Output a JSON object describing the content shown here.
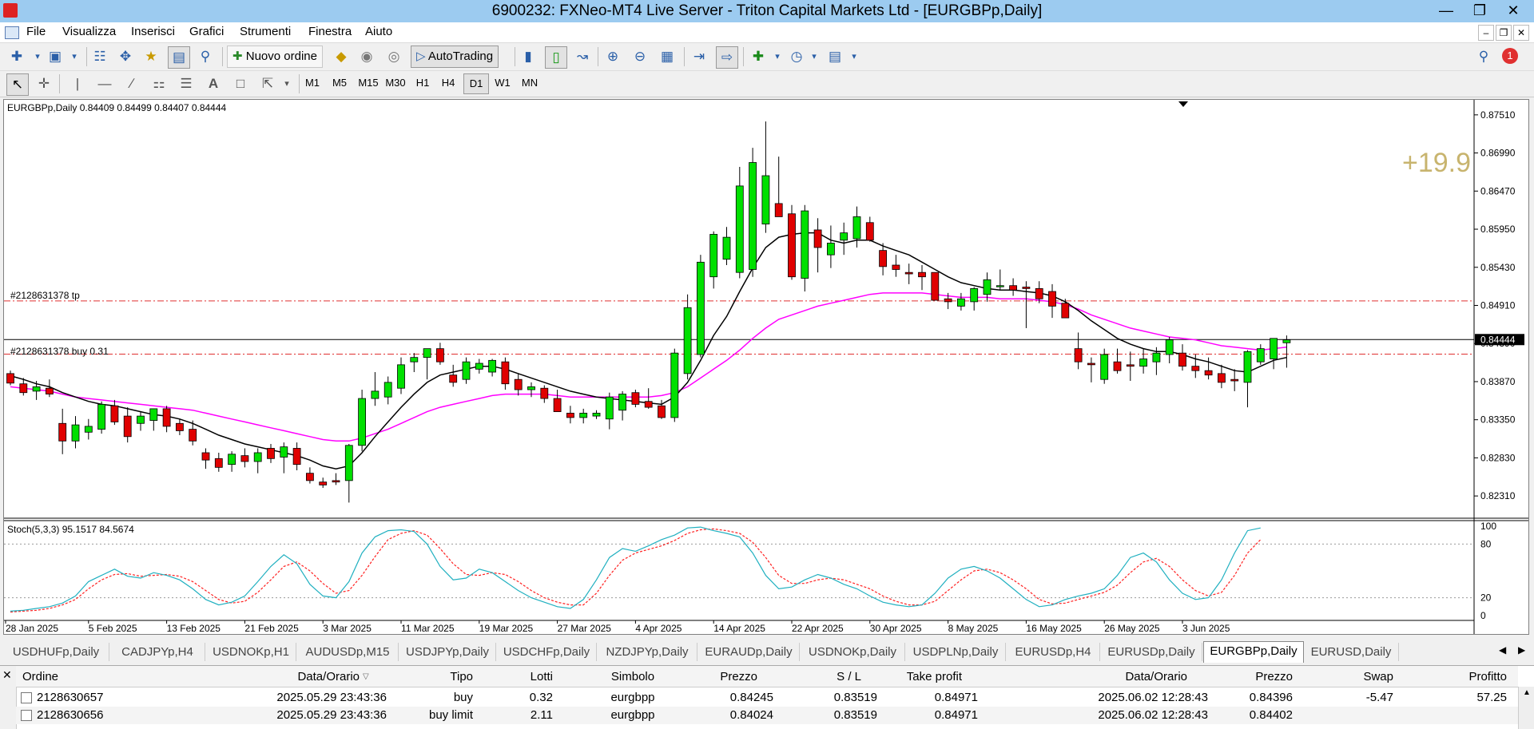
{
  "window": {
    "title": "6900232: FXNeo-MT4 Live Server - Triton Capital Markets Ltd - [EURGBPp,Daily]"
  },
  "menu": [
    "File",
    "Visualizza",
    "Inserisci",
    "Grafici",
    "Strumenti",
    "Finestra",
    "Aiuto"
  ],
  "toolbar": {
    "new_order_label": "Nuovo ordine",
    "autotrading_label": "AutoTrading",
    "alert_badge": "1"
  },
  "timeframes": [
    "M1",
    "M5",
    "M15",
    "M30",
    "H1",
    "H4",
    "D1",
    "W1",
    "MN"
  ],
  "active_timeframe": "D1",
  "chart": {
    "header": "EURGBPp,Daily  0.84409 0.84499 0.84407 0.84444",
    "profit_overlay": "+19.9",
    "tp_line_label": "#2128631378 tp",
    "buy_line_label": "#2128631378 buy 0.31",
    "current_price": "0.84444",
    "price_ticks": [
      "0.87510",
      "0.86990",
      "0.86470",
      "0.85950",
      "0.85430",
      "0.84910",
      "0.84390",
      "0.83870",
      "0.83350",
      "0.82830",
      "0.82310"
    ],
    "date_ticks": [
      "28 Jan 2025",
      "5 Feb 2025",
      "13 Feb 2025",
      "21 Feb 2025",
      "3 Mar 2025",
      "11 Mar 2025",
      "19 Mar 2025",
      "27 Mar 2025",
      "4 Apr 2025",
      "14 Apr 2025",
      "22 Apr 2025",
      "30 Apr 2025",
      "8 May 2025",
      "16 May 2025",
      "26 May 2025",
      "3 Jun 2025"
    ],
    "stoch_header": "Stoch(5,3,3) 95.1517 84.5674",
    "stoch_ticks": [
      "100",
      "80",
      "20",
      "0"
    ],
    "colors": {
      "bull": "#00e000",
      "bear": "#e00000",
      "ma_fast": "#000000",
      "ma_slow": "#ff00ff",
      "stoch_main": "#20b0c0",
      "stoch_signal": "#ff2020",
      "levels": "#e03030",
      "profit": "#c8b46e"
    }
  },
  "chart_data": {
    "type": "candlestick",
    "title": "EURGBPp,Daily",
    "ylim": [
      0.8205,
      0.8765
    ],
    "candles": [
      {
        "o": 0.8398,
        "h": 0.8402,
        "l": 0.8382,
        "c": 0.8385
      },
      {
        "o": 0.8384,
        "h": 0.8392,
        "l": 0.8368,
        "c": 0.8372
      },
      {
        "o": 0.8374,
        "h": 0.8388,
        "l": 0.8362,
        "c": 0.838
      },
      {
        "o": 0.8378,
        "h": 0.839,
        "l": 0.8366,
        "c": 0.837
      },
      {
        "o": 0.833,
        "h": 0.835,
        "l": 0.8288,
        "c": 0.8306
      },
      {
        "o": 0.8306,
        "h": 0.834,
        "l": 0.8296,
        "c": 0.8328
      },
      {
        "o": 0.8318,
        "h": 0.8336,
        "l": 0.8308,
        "c": 0.8326
      },
      {
        "o": 0.8322,
        "h": 0.836,
        "l": 0.8316,
        "c": 0.8356
      },
      {
        "o": 0.8354,
        "h": 0.8362,
        "l": 0.8328,
        "c": 0.8332
      },
      {
        "o": 0.834,
        "h": 0.8352,
        "l": 0.8304,
        "c": 0.8312
      },
      {
        "o": 0.833,
        "h": 0.8346,
        "l": 0.832,
        "c": 0.834
      },
      {
        "o": 0.8334,
        "h": 0.835,
        "l": 0.832,
        "c": 0.835
      },
      {
        "o": 0.835,
        "h": 0.8354,
        "l": 0.8318,
        "c": 0.8326
      },
      {
        "o": 0.833,
        "h": 0.8336,
        "l": 0.8314,
        "c": 0.832
      },
      {
        "o": 0.8322,
        "h": 0.8334,
        "l": 0.83,
        "c": 0.8306
      },
      {
        "o": 0.829,
        "h": 0.8296,
        "l": 0.8268,
        "c": 0.828
      },
      {
        "o": 0.8282,
        "h": 0.829,
        "l": 0.8264,
        "c": 0.827
      },
      {
        "o": 0.8274,
        "h": 0.8292,
        "l": 0.8264,
        "c": 0.8288
      },
      {
        "o": 0.8286,
        "h": 0.8296,
        "l": 0.827,
        "c": 0.8278
      },
      {
        "o": 0.8278,
        "h": 0.8296,
        "l": 0.8262,
        "c": 0.829
      },
      {
        "o": 0.8296,
        "h": 0.8302,
        "l": 0.8276,
        "c": 0.8282
      },
      {
        "o": 0.8284,
        "h": 0.8304,
        "l": 0.8262,
        "c": 0.8298
      },
      {
        "o": 0.8296,
        "h": 0.8304,
        "l": 0.8266,
        "c": 0.8274
      },
      {
        "o": 0.8262,
        "h": 0.827,
        "l": 0.8248,
        "c": 0.8252
      },
      {
        "o": 0.825,
        "h": 0.8256,
        "l": 0.8242,
        "c": 0.8246
      },
      {
        "o": 0.8252,
        "h": 0.8262,
        "l": 0.8246,
        "c": 0.825
      },
      {
        "o": 0.8252,
        "h": 0.8302,
        "l": 0.8222,
        "c": 0.83
      },
      {
        "o": 0.83,
        "h": 0.8376,
        "l": 0.8292,
        "c": 0.8364
      },
      {
        "o": 0.8364,
        "h": 0.84,
        "l": 0.8354,
        "c": 0.8374
      },
      {
        "o": 0.8366,
        "h": 0.8394,
        "l": 0.8356,
        "c": 0.8386
      },
      {
        "o": 0.8378,
        "h": 0.842,
        "l": 0.837,
        "c": 0.841
      },
      {
        "o": 0.8414,
        "h": 0.8426,
        "l": 0.84,
        "c": 0.842
      },
      {
        "o": 0.842,
        "h": 0.8432,
        "l": 0.839,
        "c": 0.8432
      },
      {
        "o": 0.8432,
        "h": 0.844,
        "l": 0.841,
        "c": 0.8414
      },
      {
        "o": 0.8396,
        "h": 0.841,
        "l": 0.838,
        "c": 0.8386
      },
      {
        "o": 0.839,
        "h": 0.842,
        "l": 0.8384,
        "c": 0.8414
      },
      {
        "o": 0.8404,
        "h": 0.8418,
        "l": 0.8398,
        "c": 0.8412
      },
      {
        "o": 0.84,
        "h": 0.8418,
        "l": 0.8394,
        "c": 0.8416
      },
      {
        "o": 0.8414,
        "h": 0.842,
        "l": 0.8376,
        "c": 0.8384
      },
      {
        "o": 0.839,
        "h": 0.8398,
        "l": 0.8368,
        "c": 0.8376
      },
      {
        "o": 0.8376,
        "h": 0.8386,
        "l": 0.8366,
        "c": 0.838
      },
      {
        "o": 0.8378,
        "h": 0.8382,
        "l": 0.8358,
        "c": 0.8364
      },
      {
        "o": 0.8364,
        "h": 0.8376,
        "l": 0.835,
        "c": 0.8346
      },
      {
        "o": 0.8344,
        "h": 0.8354,
        "l": 0.833,
        "c": 0.8338
      },
      {
        "o": 0.8338,
        "h": 0.835,
        "l": 0.833,
        "c": 0.8344
      },
      {
        "o": 0.834,
        "h": 0.8348,
        "l": 0.8336,
        "c": 0.8344
      },
      {
        "o": 0.8336,
        "h": 0.8372,
        "l": 0.8322,
        "c": 0.8366
      },
      {
        "o": 0.8348,
        "h": 0.8374,
        "l": 0.8334,
        "c": 0.837
      },
      {
        "o": 0.8372,
        "h": 0.8376,
        "l": 0.8352,
        "c": 0.8356
      },
      {
        "o": 0.836,
        "h": 0.8378,
        "l": 0.835,
        "c": 0.8352
      },
      {
        "o": 0.8354,
        "h": 0.8362,
        "l": 0.8336,
        "c": 0.8338
      },
      {
        "o": 0.8338,
        "h": 0.8432,
        "l": 0.8332,
        "c": 0.8426
      },
      {
        "o": 0.8398,
        "h": 0.8506,
        "l": 0.839,
        "c": 0.8488
      },
      {
        "o": 0.8424,
        "h": 0.856,
        "l": 0.842,
        "c": 0.855
      },
      {
        "o": 0.853,
        "h": 0.8592,
        "l": 0.8514,
        "c": 0.8588
      },
      {
        "o": 0.8554,
        "h": 0.8598,
        "l": 0.8546,
        "c": 0.8584
      },
      {
        "o": 0.8536,
        "h": 0.868,
        "l": 0.8528,
        "c": 0.8654
      },
      {
        "o": 0.854,
        "h": 0.8706,
        "l": 0.853,
        "c": 0.8686
      },
      {
        "o": 0.8602,
        "h": 0.8742,
        "l": 0.859,
        "c": 0.8668
      },
      {
        "o": 0.863,
        "h": 0.8694,
        "l": 0.8612,
        "c": 0.8612
      },
      {
        "o": 0.8616,
        "h": 0.8628,
        "l": 0.8526,
        "c": 0.853
      },
      {
        "o": 0.8528,
        "h": 0.8628,
        "l": 0.851,
        "c": 0.862
      },
      {
        "o": 0.8594,
        "h": 0.861,
        "l": 0.8536,
        "c": 0.857
      },
      {
        "o": 0.856,
        "h": 0.86,
        "l": 0.8542,
        "c": 0.8576
      },
      {
        "o": 0.858,
        "h": 0.8604,
        "l": 0.856,
        "c": 0.859
      },
      {
        "o": 0.8582,
        "h": 0.8626,
        "l": 0.857,
        "c": 0.8612
      },
      {
        "o": 0.8604,
        "h": 0.8612,
        "l": 0.8578,
        "c": 0.858
      },
      {
        "o": 0.8566,
        "h": 0.8576,
        "l": 0.8532,
        "c": 0.8544
      },
      {
        "o": 0.8546,
        "h": 0.856,
        "l": 0.853,
        "c": 0.854
      },
      {
        "o": 0.8536,
        "h": 0.8548,
        "l": 0.852,
        "c": 0.8534
      },
      {
        "o": 0.8536,
        "h": 0.8546,
        "l": 0.8512,
        "c": 0.853
      },
      {
        "o": 0.8536,
        "h": 0.8536,
        "l": 0.8498,
        "c": 0.8498
      },
      {
        "o": 0.85,
        "h": 0.8508,
        "l": 0.8486,
        "c": 0.8496
      },
      {
        "o": 0.849,
        "h": 0.8508,
        "l": 0.8484,
        "c": 0.85
      },
      {
        "o": 0.8496,
        "h": 0.8516,
        "l": 0.8484,
        "c": 0.8514
      },
      {
        "o": 0.8506,
        "h": 0.8536,
        "l": 0.8496,
        "c": 0.8526
      },
      {
        "o": 0.8518,
        "h": 0.854,
        "l": 0.8512,
        "c": 0.8518
      },
      {
        "o": 0.8518,
        "h": 0.8528,
        "l": 0.8504,
        "c": 0.8512
      },
      {
        "o": 0.8516,
        "h": 0.8524,
        "l": 0.846,
        "c": 0.8514
      },
      {
        "o": 0.8514,
        "h": 0.8524,
        "l": 0.8494,
        "c": 0.85
      },
      {
        "o": 0.851,
        "h": 0.852,
        "l": 0.8474,
        "c": 0.849
      },
      {
        "o": 0.8494,
        "h": 0.85,
        "l": 0.8474,
        "c": 0.8474
      },
      {
        "o": 0.8432,
        "h": 0.8454,
        "l": 0.8404,
        "c": 0.8414
      },
      {
        "o": 0.8412,
        "h": 0.842,
        "l": 0.8386,
        "c": 0.841
      },
      {
        "o": 0.839,
        "h": 0.8432,
        "l": 0.8384,
        "c": 0.8424
      },
      {
        "o": 0.8414,
        "h": 0.8432,
        "l": 0.8398,
        "c": 0.8402
      },
      {
        "o": 0.841,
        "h": 0.8428,
        "l": 0.8388,
        "c": 0.8408
      },
      {
        "o": 0.8408,
        "h": 0.8432,
        "l": 0.8398,
        "c": 0.8418
      },
      {
        "o": 0.8414,
        "h": 0.8434,
        "l": 0.8396,
        "c": 0.8426
      },
      {
        "o": 0.8424,
        "h": 0.8448,
        "l": 0.8412,
        "c": 0.8444
      },
      {
        "o": 0.8426,
        "h": 0.8438,
        "l": 0.8402,
        "c": 0.8408
      },
      {
        "o": 0.8408,
        "h": 0.8424,
        "l": 0.8392,
        "c": 0.8402
      },
      {
        "o": 0.8402,
        "h": 0.842,
        "l": 0.839,
        "c": 0.8396
      },
      {
        "o": 0.8398,
        "h": 0.841,
        "l": 0.8378,
        "c": 0.8386
      },
      {
        "o": 0.839,
        "h": 0.8404,
        "l": 0.8374,
        "c": 0.8388
      },
      {
        "o": 0.8386,
        "h": 0.843,
        "l": 0.8352,
        "c": 0.8428
      },
      {
        "o": 0.8414,
        "h": 0.8438,
        "l": 0.841,
        "c": 0.8432
      },
      {
        "o": 0.8418,
        "h": 0.8446,
        "l": 0.8404,
        "c": 0.8446
      },
      {
        "o": 0.844,
        "h": 0.845,
        "l": 0.8406,
        "c": 0.8444
      }
    ],
    "levels": {
      "tp": 0.84971,
      "buy": 0.84245,
      "bid": 0.84444
    },
    "ma_fast": [
      0.8395,
      0.839,
      0.8384,
      0.838,
      0.8372,
      0.8366,
      0.836,
      0.8356,
      0.8354,
      0.835,
      0.8346,
      0.8342,
      0.834,
      0.8336,
      0.833,
      0.8322,
      0.8314,
      0.8308,
      0.8302,
      0.8298,
      0.8294,
      0.829,
      0.8286,
      0.828,
      0.8272,
      0.8268,
      0.8272,
      0.829,
      0.8312,
      0.8332,
      0.8352,
      0.837,
      0.8386,
      0.8396,
      0.84,
      0.8404,
      0.8408,
      0.8408,
      0.8404,
      0.8398,
      0.8392,
      0.8386,
      0.838,
      0.8374,
      0.837,
      0.8366,
      0.8364,
      0.8362,
      0.836,
      0.8358,
      0.8356,
      0.8366,
      0.8386,
      0.8416,
      0.845,
      0.8476,
      0.851,
      0.8542,
      0.857,
      0.8584,
      0.8588,
      0.859,
      0.859,
      0.858,
      0.8576,
      0.858,
      0.858,
      0.8572,
      0.8566,
      0.856,
      0.855,
      0.854,
      0.853,
      0.8522,
      0.8518,
      0.8514,
      0.8512,
      0.8512,
      0.851,
      0.8508,
      0.8504,
      0.8496,
      0.8484,
      0.847,
      0.8458,
      0.8446,
      0.8438,
      0.8432,
      0.8428,
      0.8428,
      0.8424,
      0.8418,
      0.8414,
      0.8408,
      0.8402,
      0.84,
      0.8408,
      0.8416,
      0.842
    ],
    "ma_slow": [
      0.838,
      0.8378,
      0.8376,
      0.8374,
      0.837,
      0.8366,
      0.8364,
      0.8362,
      0.836,
      0.8358,
      0.8356,
      0.8354,
      0.8352,
      0.835,
      0.8348,
      0.8344,
      0.834,
      0.8336,
      0.8332,
      0.8328,
      0.8324,
      0.832,
      0.8316,
      0.8312,
      0.8308,
      0.8306,
      0.8306,
      0.831,
      0.8316,
      0.8322,
      0.833,
      0.8338,
      0.8346,
      0.8352,
      0.8356,
      0.836,
      0.8364,
      0.8368,
      0.837,
      0.837,
      0.837,
      0.837,
      0.8368,
      0.8366,
      0.8366,
      0.8366,
      0.8366,
      0.8366,
      0.8366,
      0.8366,
      0.8368,
      0.8372,
      0.838,
      0.8392,
      0.8404,
      0.8416,
      0.843,
      0.8446,
      0.846,
      0.8472,
      0.8478,
      0.8484,
      0.849,
      0.8494,
      0.8498,
      0.8502,
      0.8506,
      0.8508,
      0.8508,
      0.8508,
      0.8508,
      0.8506,
      0.8504,
      0.8502,
      0.8502,
      0.8502,
      0.85,
      0.85,
      0.85,
      0.8498,
      0.8496,
      0.8492,
      0.8486,
      0.8478,
      0.8472,
      0.8466,
      0.846,
      0.8456,
      0.8452,
      0.8448,
      0.8446,
      0.8444,
      0.844,
      0.8436,
      0.8434,
      0.8432,
      0.843,
      0.8432,
      0.8434
    ],
    "stoch_main": [
      5,
      6,
      8,
      10,
      14,
      22,
      38,
      45,
      52,
      44,
      42,
      48,
      45,
      40,
      30,
      18,
      12,
      15,
      22,
      38,
      55,
      68,
      58,
      35,
      22,
      20,
      38,
      70,
      88,
      95,
      96,
      94,
      80,
      55,
      40,
      42,
      52,
      48,
      38,
      28,
      20,
      15,
      10,
      8,
      18,
      40,
      65,
      75,
      72,
      78,
      85,
      90,
      98,
      99,
      95,
      92,
      88,
      70,
      45,
      30,
      32,
      40,
      46,
      42,
      35,
      30,
      22,
      15,
      12,
      10,
      12,
      25,
      42,
      52,
      55,
      50,
      42,
      30,
      18,
      10,
      12,
      18,
      22,
      25,
      30,
      45,
      65,
      70,
      60,
      40,
      25,
      18,
      20,
      40,
      70,
      95,
      98
    ],
    "stoch_signal": [
      4,
      5,
      6,
      8,
      12,
      18,
      30,
      40,
      46,
      47,
      44,
      45,
      46,
      44,
      38,
      28,
      18,
      14,
      16,
      26,
      40,
      55,
      60,
      50,
      36,
      25,
      28,
      45,
      66,
      85,
      92,
      95,
      90,
      75,
      58,
      46,
      45,
      48,
      46,
      38,
      28,
      20,
      15,
      12,
      12,
      25,
      45,
      62,
      70,
      74,
      78,
      84,
      92,
      96,
      97,
      95,
      92,
      82,
      65,
      45,
      36,
      36,
      40,
      42,
      40,
      35,
      30,
      22,
      16,
      12,
      12,
      16,
      28,
      40,
      50,
      52,
      48,
      40,
      30,
      18,
      13,
      14,
      18,
      22,
      26,
      34,
      48,
      60,
      64,
      55,
      40,
      28,
      22,
      26,
      45,
      70,
      85
    ]
  },
  "tabs": [
    "USDHUFp,Daily",
    "CADJPYp,H4",
    "USDNOKp,H1",
    "AUDUSDp,M15",
    "USDJPYp,Daily",
    "USDCHFp,Daily",
    "NZDJPYp,Daily",
    "EURAUDp,Daily",
    "USDNOKp,Daily",
    "USDPLNp,Daily",
    "EURUSDp,H4",
    "EURUSDp,Daily",
    "EURGBPp,Daily",
    "EURUSD,Daily"
  ],
  "active_tab": "EURGBPp,Daily",
  "terminal": {
    "headers": {
      "order": "Ordine",
      "open_time": "Data/Orario",
      "type": "Tipo",
      "lots": "Lotti",
      "symbol": "Simbolo",
      "price": "Prezzo",
      "sl": "S / L",
      "tp": "Take profit",
      "time": "Data/Orario",
      "cur_price": "Prezzo",
      "swap": "Swap",
      "profit": "Profitto"
    },
    "rows": [
      {
        "order": "2128630657",
        "open_time": "2025.05.29 23:43:36",
        "type": "buy",
        "lots": "0.32",
        "symbol": "eurgbpp",
        "price": "0.84245",
        "sl": "0.83519",
        "tp": "0.84971",
        "time": "2025.06.02 12:28:43",
        "cur_price": "0.84396",
        "swap": "-5.47",
        "profit": "57.25"
      },
      {
        "order": "2128630656",
        "open_time": "2025.05.29 23:43:36",
        "type": "buy limit",
        "lots": "2.11",
        "symbol": "eurgbpp",
        "price": "0.84024",
        "sl": "0.83519",
        "tp": "0.84971",
        "time": "2025.06.02 12:28:43",
        "cur_price": "0.84402",
        "swap": "",
        "profit": ""
      }
    ]
  }
}
